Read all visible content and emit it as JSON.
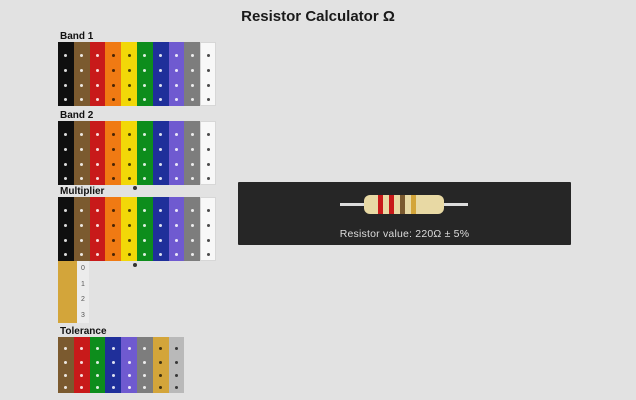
{
  "app": {
    "title": "Resistor Calculator Ω"
  },
  "sections": [
    {
      "label": "Band 1"
    },
    {
      "label": "Band 2"
    },
    {
      "label": "Multiplier"
    },
    {
      "label": "Tolerance"
    }
  ],
  "result": {
    "text": "Resistor value: 220Ω ± 5%"
  },
  "colors": {
    "black": "#0f0f0f",
    "brown": "#7b5a2f",
    "red": "#c81a1a",
    "orange": "#f07a13",
    "yellow": "#f2d808",
    "green": "#0d8d1c",
    "blue": "#1f2f9a",
    "violet": "#6f5ad0",
    "grey": "#7d7d7d",
    "white": "#f8f8f8",
    "gold": "#d3a53a",
    "silver": "#b9b9b9",
    "panel": "#262626",
    "resistor_body": "#e8d9a4"
  },
  "band_palette": [
    "black",
    "brown",
    "red",
    "orange",
    "yellow",
    "green",
    "blue",
    "violet",
    "grey",
    "white"
  ],
  "tolerance_palette": [
    "brown",
    "red",
    "green",
    "blue",
    "violet",
    "grey",
    "gold",
    "silver"
  ],
  "extra_palette": [
    "gold"
  ],
  "extra_digits": [
    "0",
    "1",
    "2",
    "3"
  ],
  "selected_bands": [
    "red",
    "red",
    "brown",
    "gold"
  ]
}
